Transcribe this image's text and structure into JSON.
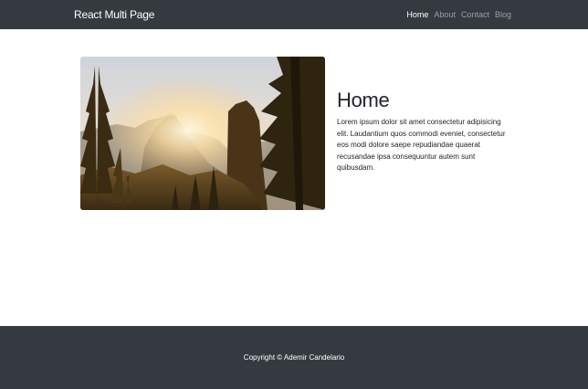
{
  "navbar": {
    "brand": "React Multi Page",
    "links": [
      {
        "label": "Home"
      },
      {
        "label": "About"
      },
      {
        "label": "Contact"
      },
      {
        "label": "Blog"
      }
    ]
  },
  "main": {
    "heading": "Home",
    "paragraph": "Lorem ipsum dolor sit amet consectetur adipisicing elit. Laudantium quos commodi eveniet, consectetur eos modi dolore saepe repudiandae quaerat recusandae ipsa consequuntur autem sunt quibusdam."
  },
  "footer": {
    "copyright": "Copyright © Ademir Candelario"
  },
  "colors": {
    "navbar_bg": "#343a40",
    "footer_bg": "#343a40",
    "text": "#212529"
  }
}
